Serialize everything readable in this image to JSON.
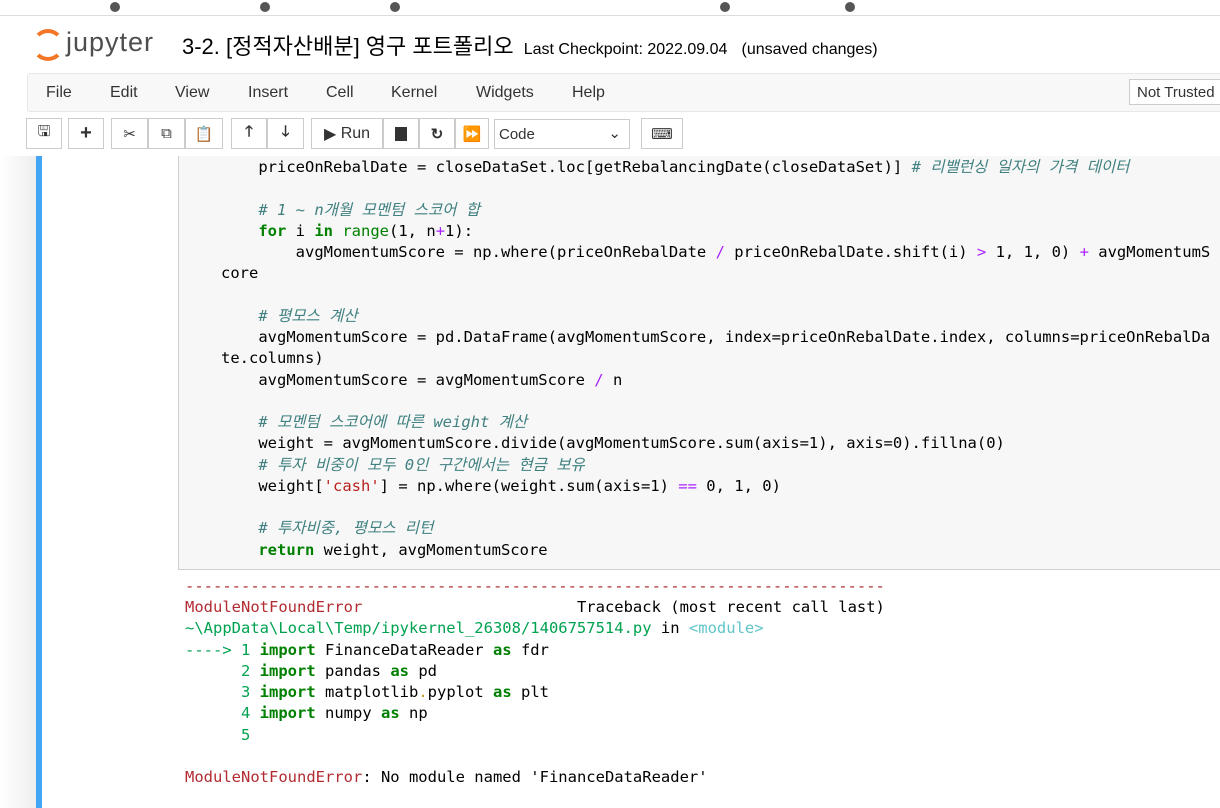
{
  "header": {
    "logo": "jupyter",
    "notebook_title": "3-2. [정적자산배분] 영구 포트폴리오",
    "checkpoint": "Last Checkpoint: 2022.09.04",
    "save_status": "(unsaved changes)"
  },
  "menu": [
    "File",
    "Edit",
    "View",
    "Insert",
    "Cell",
    "Kernel",
    "Widgets",
    "Help"
  ],
  "trust": "Not Trusted",
  "toolbar": {
    "run_label": "Run",
    "cell_type": "Code",
    "icons": [
      "save-icon",
      "plus-icon",
      "cut-icon",
      "copy-icon",
      "paste-icon",
      "arrow-up-icon",
      "arrow-down-icon",
      "run-icon",
      "stop-icon",
      "restart-icon",
      "fast-forward-icon",
      "keyboard-icon"
    ]
  },
  "code": [
    [
      [
        "    priceOnRebalDate ",
        ""
      ],
      [
        "=",
        ""
      ],
      [
        " closeDataSet.loc[getRebalancingDate(closeDataSet)] ",
        ""
      ],
      [
        "# 리밸런싱 일자의 가격 데이터",
        "c"
      ]
    ],
    [],
    [
      [
        "    ",
        ""
      ],
      [
        "# 1 ~ n개월 모멘텀 스코어 합",
        "c"
      ]
    ],
    [
      [
        "    ",
        ""
      ],
      [
        "for",
        "k"
      ],
      [
        " i ",
        ""
      ],
      [
        "in",
        "k"
      ],
      [
        " ",
        ""
      ],
      [
        "range",
        "b"
      ],
      [
        "(1, n",
        ""
      ],
      [
        "+",
        "o"
      ],
      [
        "1):",
        ""
      ]
    ],
    [
      [
        "        avgMomentumScore = np.where(priceOnRebalDate ",
        ""
      ],
      [
        "/",
        "o"
      ],
      [
        " priceOnRebalDate.shift(i) ",
        ""
      ],
      [
        ">",
        "o"
      ],
      [
        " 1, 1, 0) ",
        ""
      ],
      [
        "+",
        "o"
      ],
      [
        " avgMomentumScore",
        ""
      ]
    ],
    [],
    [
      [
        "    ",
        ""
      ],
      [
        "# 평모스 계산",
        "c"
      ]
    ],
    [
      [
        "    avgMomentumScore = pd.DataFrame(avgMomentumScore, index=priceOnRebalDate.index, columns=priceOnRebalDate.columns)",
        ""
      ]
    ],
    [
      [
        "    avgMomentumScore = avgMomentumScore ",
        ""
      ],
      [
        "/",
        "o"
      ],
      [
        " n",
        ""
      ]
    ],
    [],
    [
      [
        "    ",
        ""
      ],
      [
        "# 모멘텀 스코어에 따른 weight 계산",
        "c"
      ]
    ],
    [
      [
        "    weight = avgMomentumScore.divide(avgMomentumScore.sum(axis=1), axis=0).fillna(0)",
        ""
      ]
    ],
    [
      [
        "    ",
        ""
      ],
      [
        "# 투자 비중이 모두 0인 구간에서는 현금 보유",
        "c"
      ]
    ],
    [
      [
        "    weight[",
        ""
      ],
      [
        "'cash'",
        "s"
      ],
      [
        "] = np.where(weight.sum(axis=1) ",
        ""
      ],
      [
        "==",
        "o"
      ],
      [
        " 0, 1, 0)",
        ""
      ]
    ],
    [],
    [
      [
        "    ",
        ""
      ],
      [
        "# 투자비중, 평모스 리턴",
        "c"
      ]
    ],
    [
      [
        "    ",
        ""
      ],
      [
        "return",
        "k"
      ],
      [
        " weight, avgMomentumScore",
        ""
      ]
    ]
  ],
  "output": [
    [
      [
        "---------------------------------------------------------------------------",
        "er"
      ]
    ],
    [
      [
        "ModuleNotFoundError",
        "er"
      ],
      [
        "                       Traceback (most recent call last)",
        ""
      ]
    ],
    [
      [
        "~\\AppData\\Local\\Temp/ipykernel_26308/1406757514.py",
        "gr"
      ],
      [
        " in ",
        ""
      ],
      [
        "<module>",
        "cy"
      ]
    ],
    [
      [
        "----> 1 ",
        "gr"
      ],
      [
        "import",
        "kg"
      ],
      [
        " FinanceDataReader ",
        ""
      ],
      [
        "as",
        "kg"
      ],
      [
        " fdr",
        ""
      ]
    ],
    [
      [
        "      2 ",
        "gr"
      ],
      [
        "import",
        "kg"
      ],
      [
        " pandas ",
        ""
      ],
      [
        "as",
        "kg"
      ],
      [
        " pd",
        ""
      ]
    ],
    [
      [
        "      3 ",
        "gr"
      ],
      [
        "import",
        "kg"
      ],
      [
        " matplotlib",
        ""
      ],
      [
        ".",
        "y"
      ],
      [
        "pyplot ",
        ""
      ],
      [
        "as",
        "kg"
      ],
      [
        " plt",
        ""
      ]
    ],
    [
      [
        "      4 ",
        "gr"
      ],
      [
        "import",
        "kg"
      ],
      [
        " numpy ",
        ""
      ],
      [
        "as",
        "kg"
      ],
      [
        " np",
        ""
      ]
    ],
    [
      [
        "      5",
        "gr"
      ]
    ],
    [],
    [
      [
        "ModuleNotFoundError",
        "er"
      ],
      [
        ": No module named 'FinanceDataReader'",
        ""
      ]
    ]
  ]
}
